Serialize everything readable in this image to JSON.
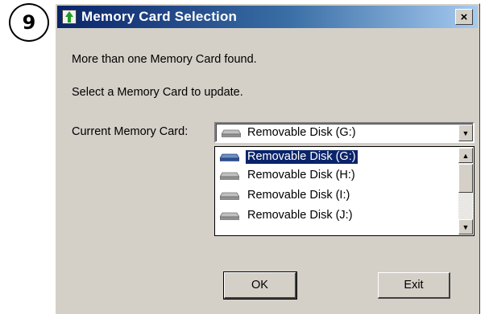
{
  "step_number": "9",
  "dialog": {
    "title": "Memory Card Selection",
    "close_symbol": "×",
    "message_line1": "More than one Memory Card found.",
    "message_line2": "Select a Memory Card to update.",
    "current_card_label": "Current Memory Card:"
  },
  "combo": {
    "selected_value": "Removable Disk (G:)",
    "icon": "drive-icon",
    "arrow_symbol": "▼"
  },
  "dropdown": {
    "items": [
      {
        "label": "Removable Disk (G:)",
        "selected": true
      },
      {
        "label": "Removable Disk (H:)",
        "selected": false
      },
      {
        "label": "Removable Disk (I:)",
        "selected": false
      },
      {
        "label": "Removable Disk (J:)",
        "selected": false
      }
    ],
    "scroll_up_symbol": "▲",
    "scroll_down_symbol": "▼"
  },
  "buttons": {
    "ok_label": "OK",
    "exit_label": "Exit"
  },
  "colors": {
    "titlebar_start": "#0a246a",
    "titlebar_end": "#a6caf0",
    "dialog_face": "#d4d0c8",
    "selection": "#0a246a"
  }
}
